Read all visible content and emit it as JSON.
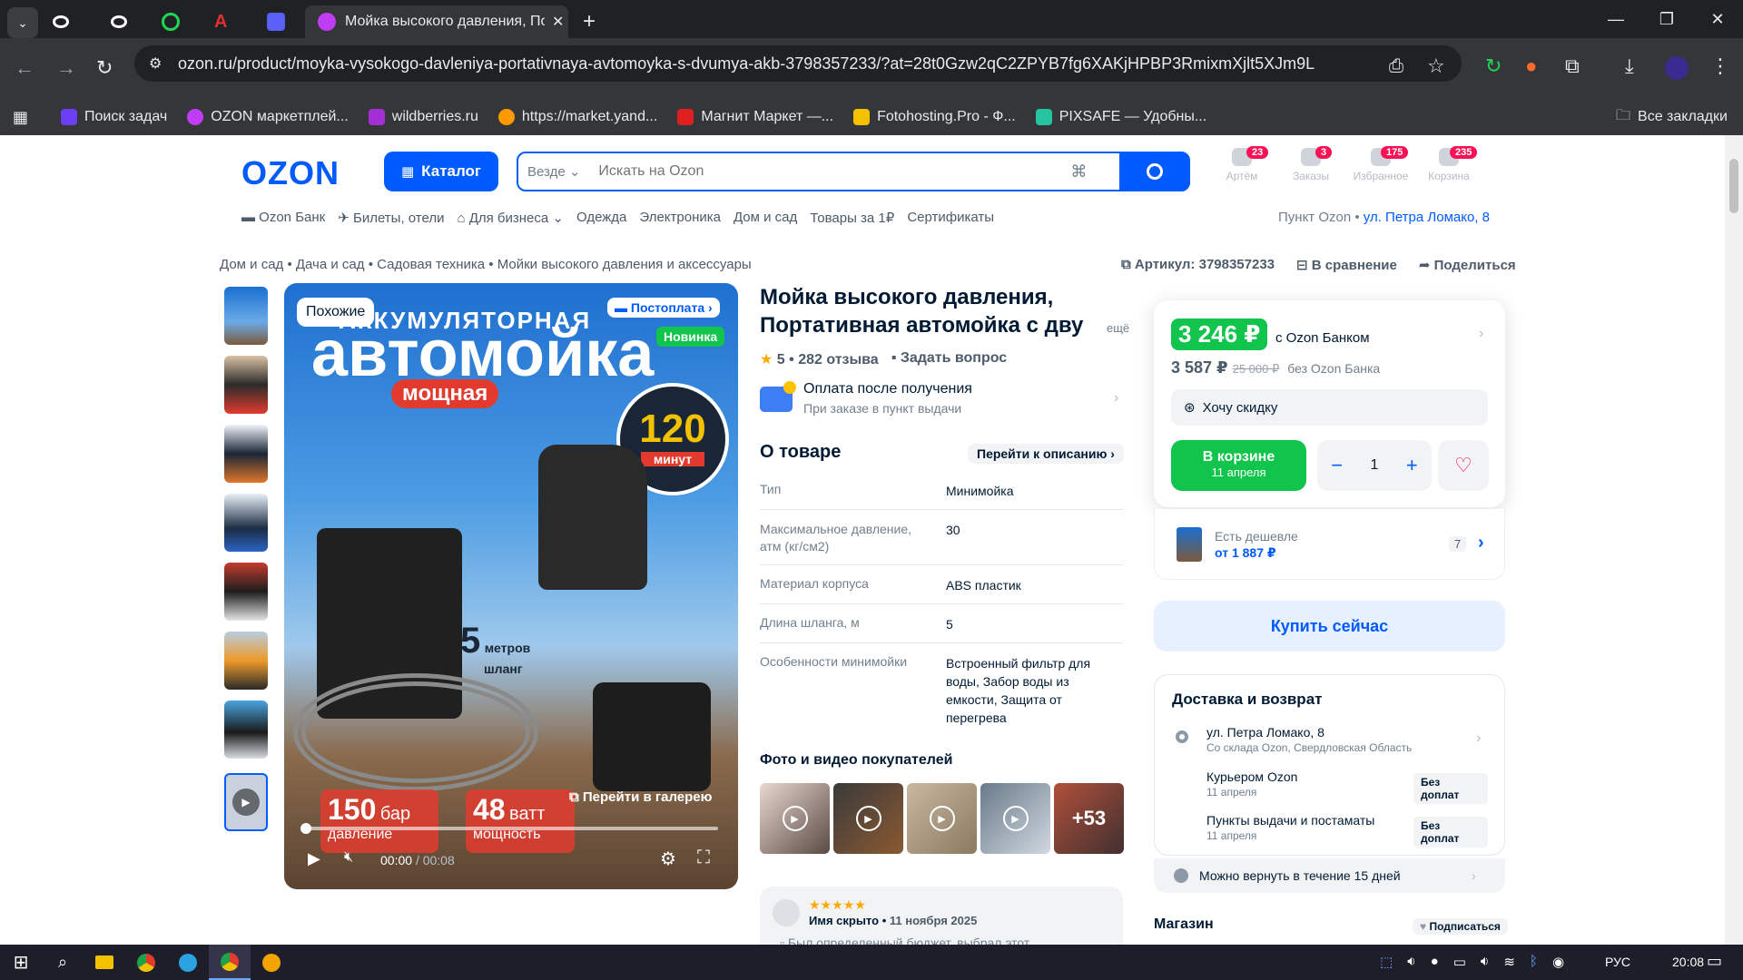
{
  "browser": {
    "active_tab_title": "Мойка высокого давления, По",
    "url": "ozon.ru/product/moyka-vysokogo-davleniya-portativnaya-avtomoyka-s-dvumya-akb-3798357233/?at=28t0Gzw2qC2ZPYB7fg6XAKjHPBP3RmixmXjlt5XJm9L",
    "bookmarks": [
      {
        "label": "Поиск задач",
        "color": "#6b3df5"
      },
      {
        "label": "OZON маркетплей...",
        "color": "#c03df5"
      },
      {
        "label": "wildberries.ru",
        "color": "#a42fd6"
      },
      {
        "label": "https://market.yand...",
        "color": "#ff9900"
      },
      {
        "label": "Магнит Маркет —...",
        "color": "#e02020"
      },
      {
        "label": "Fotohosting.Pro - Ф...",
        "color": "#f2c200"
      },
      {
        "label": "PIXSAFE — Удобны...",
        "color": "#24c5a0"
      }
    ],
    "all_bookmarks": "Все закладки"
  },
  "header": {
    "logo": "OZON",
    "catalog": "Каталог",
    "search_scope": "Везде",
    "search_placeholder": "Искать на Ozon",
    "nav": [
      {
        "label": "Артём",
        "badge": "23"
      },
      {
        "label": "Заказы",
        "badge": "3"
      },
      {
        "label": "Избранное",
        "badge": "175"
      },
      {
        "label": "Корзина",
        "badge": "235"
      }
    ],
    "subnav": [
      "Ozon Банк",
      "Билеты, отели",
      "Для бизнеса",
      "Одежда",
      "Электроника",
      "Дом и сад",
      "Товары за 1₽",
      "Сертификаты"
    ],
    "pickup_label": "Пункт Ozon •",
    "pickup_address": "ул. Петра Ломако, 8"
  },
  "breadcrumbs": [
    "Дом и сад",
    "Дача и сад",
    "Садовая техника",
    "Мойки высокого давления и аксессуары"
  ],
  "product_actions": {
    "article": "Артикул: 3798357233",
    "compare": "В сравнение",
    "share": "Поделиться"
  },
  "gallery": {
    "similar": "Похожие",
    "postpay": "Постоплата",
    "new_badge": "Новинка",
    "image_text_1": "АККУМУЛЯТОРНАЯ",
    "image_text_2": "автомойка",
    "image_text_3": "мощная",
    "minutes_value": "120",
    "minutes_label": "минут",
    "hose_value": "5",
    "hose_label_1": "метров",
    "hose_label_2": "шланг",
    "bar_value": "150",
    "bar_unit": "бар",
    "bar_label": "давление",
    "watt_value": "48",
    "watt_unit": "ватт",
    "watt_label": "мощность",
    "gallery_link": "Перейти в галерею",
    "time_current": "00:00",
    "time_total": "/ 00:08"
  },
  "product": {
    "title": "Мойка высокого давления, Портативная автомойка с дву",
    "more": "ещё",
    "rating": "5 • 282 отзыва",
    "ask": "Задать вопрос",
    "payment_title": "Оплата после получения",
    "payment_sub": "При заказе в пункт выдачи",
    "about_title": "О товаре",
    "goto_desc": "Перейти к описанию",
    "specs": [
      {
        "k": "Тип",
        "v": "Минимойка"
      },
      {
        "k": "Максимальное давление, атм (кг/см2)",
        "v": "30"
      },
      {
        "k": "Материал корпуса",
        "v": "ABS пластик"
      },
      {
        "k": "Длина шланга, м",
        "v": "5"
      },
      {
        "k": "Особенности минимойки",
        "v": "Встроенный фильтр для воды, Забор воды из емкости, Защита от перегрева"
      }
    ],
    "photos_title": "Фото и видео покупателей",
    "photos_more": "+53",
    "review_author": "Имя скрыто",
    "review_date": "11 ноября 2025",
    "review_text": "Был определенный бюджет, выбрал этот"
  },
  "buy": {
    "price_bank": "3 246 ₽",
    "with_bank": "с Ozon Банком",
    "price": "3 587 ₽",
    "old_price": "25 000 ₽",
    "without_bank": "без Ozon Банка",
    "want_discount": "Хочу скидку",
    "in_cart": "В корзине",
    "in_cart_date": "11 апреля",
    "qty": "1",
    "cheaper_label": "Есть дешевле",
    "cheaper_price": "от 1 887 ₽",
    "cheaper_count": "7",
    "buy_now": "Купить сейчас"
  },
  "delivery": {
    "title": "Доставка и возврат",
    "address": "ул. Петра Ломако, 8",
    "address_sub": "Со склада Ozon, Свердловская Область",
    "courier": "Курьером Ozon",
    "courier_date": "11 апреля",
    "courier_tag": "Без доплат",
    "points": "Пункты выдачи и постаматы",
    "points_date": "11 апреля",
    "points_tag": "Без доплат",
    "return": "Можно вернуть в течение 15 дней"
  },
  "shop": {
    "title": "Магазин",
    "subscribe": "Подписаться"
  },
  "taskbar": {
    "lang": "РУС",
    "time": "20:08"
  }
}
